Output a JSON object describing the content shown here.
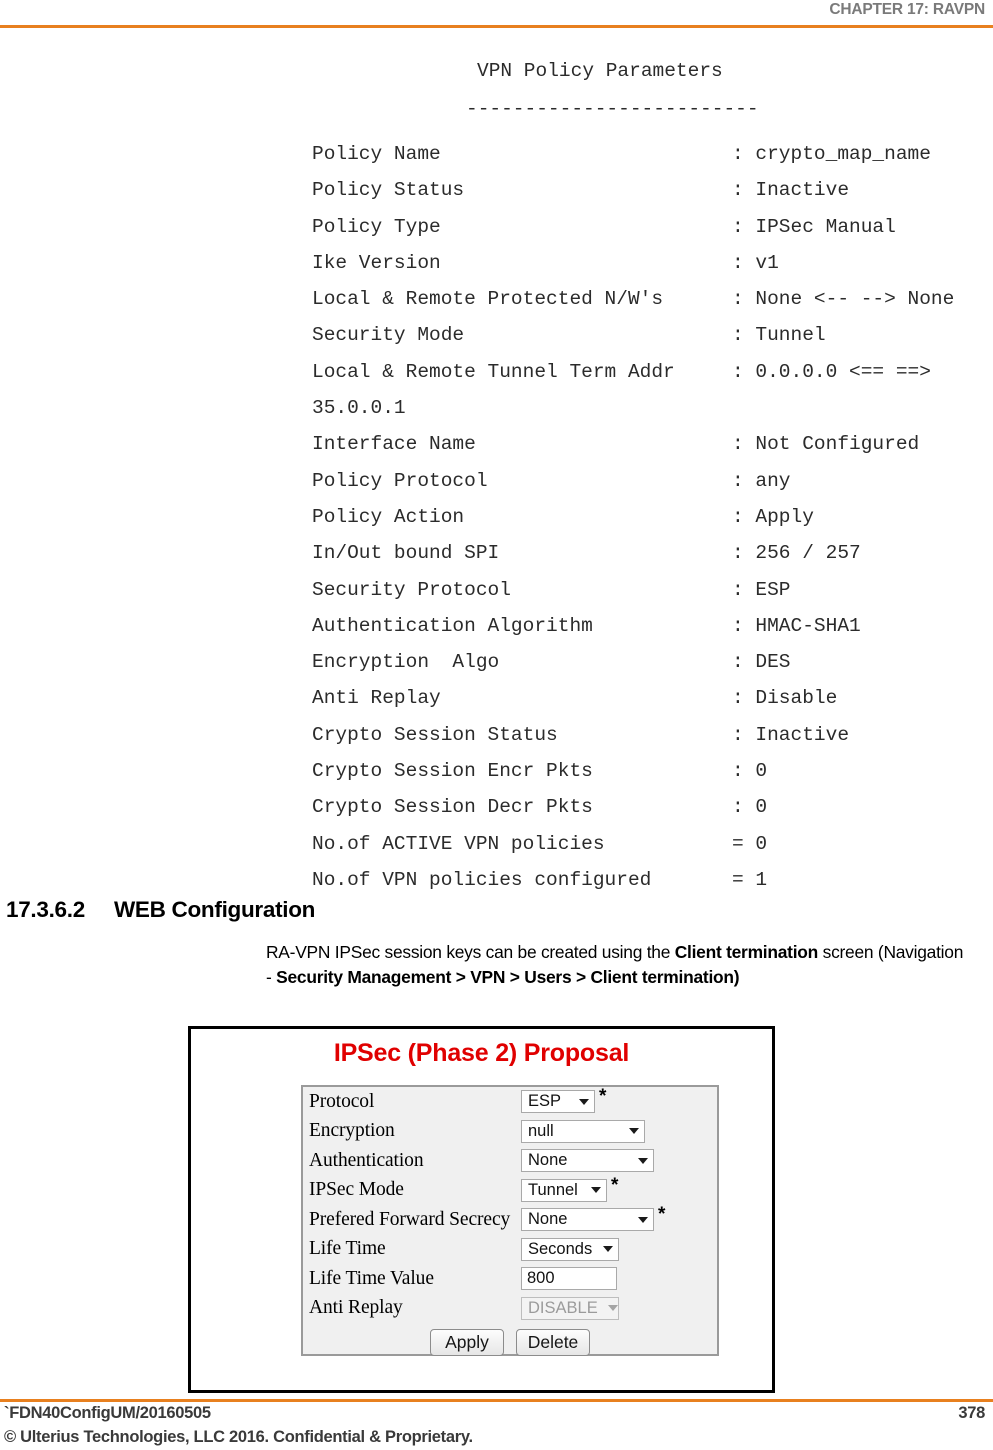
{
  "header": {
    "chapter": "CHAPTER 17: RAVPN"
  },
  "cli": {
    "title": "VPN Policy Parameters",
    "divider": "-------------------------",
    "rows": [
      {
        "key": "Policy Name",
        "value": ": crypto_map_name"
      },
      {
        "key": "Policy Status",
        "value": ": Inactive"
      },
      {
        "key": "Policy Type",
        "value": ": IPSec Manual"
      },
      {
        "key": "Ike Version",
        "value": ": v1"
      },
      {
        "key": "Local & Remote Protected N/W's",
        "value": ": None <-- --> None"
      },
      {
        "key": "Security Mode",
        "value": ": Tunnel"
      },
      {
        "key": "Local & Remote Tunnel Term Addr",
        "value": ": 0.0.0.0 <== ==> 35.0.0.1"
      },
      {
        "key": "Interface Name",
        "value": ": Not Configured"
      },
      {
        "key": "Policy Protocol",
        "value": ": any"
      },
      {
        "key": "Policy Action",
        "value": ": Apply"
      },
      {
        "key": "In/Out bound SPI",
        "value": ": 256 / 257"
      },
      {
        "key": "Security Protocol",
        "value": ": ESP"
      },
      {
        "key": "Authentication Algorithm",
        "value": ": HMAC-SHA1"
      },
      {
        "key": "Encryption  Algo",
        "value": ": DES"
      },
      {
        "key": "Anti Replay",
        "value": ": Disable"
      },
      {
        "key": "Crypto Session Status",
        "value": ": Inactive"
      },
      {
        "key": "Crypto Session Encr Pkts",
        "value": ": 0"
      },
      {
        "key": "Crypto Session Decr Pkts",
        "value": ": 0"
      },
      {
        "key": "No.of ACTIVE VPN policies",
        "value": "= 0"
      },
      {
        "key": "No.of VPN policies configured",
        "value": "= 1"
      }
    ]
  },
  "section": {
    "number": "17.3.6.2",
    "title": "WEB Configuration",
    "paragraph": {
      "part1": "RA-VPN IPSec session keys can be created using the ",
      "bold1": "Client termination",
      "part2": " screen (Navigation - ",
      "bold2": "Security Management > VPN > Users > Client termination)"
    }
  },
  "screenshot": {
    "title": "IPSec (Phase 2) Proposal",
    "title_color": "#e00000",
    "rows": [
      {
        "label": "Protocol",
        "control": "dropdown",
        "value": "ESP",
        "width": "w-short",
        "required": "*",
        "disabled": false
      },
      {
        "label": "Encryption",
        "control": "dropdown",
        "value": "null",
        "width": "w-med",
        "required": "",
        "disabled": false
      },
      {
        "label": "Authentication",
        "control": "dropdown",
        "value": "None",
        "width": "w-wide",
        "required": "",
        "disabled": false
      },
      {
        "label": "IPSec Mode",
        "control": "dropdown",
        "value": "Tunnel",
        "width": "w-tunnel",
        "required": "*",
        "disabled": false
      },
      {
        "label": "Prefered Forward Secrecy",
        "control": "dropdown",
        "value": "None",
        "width": "w-wide",
        "required": "*",
        "disabled": false
      },
      {
        "label": "Life Time",
        "control": "dropdown",
        "value": "Seconds",
        "width": "w-sec",
        "required": "",
        "disabled": false
      },
      {
        "label": "Life Time Value",
        "control": "input",
        "value": "800",
        "width": "",
        "required": "",
        "disabled": false
      },
      {
        "label": "Anti Replay",
        "control": "dropdown",
        "value": "DISABLE",
        "width": "w-dis",
        "required": "",
        "disabled": true
      }
    ],
    "buttons": [
      {
        "label": "Apply"
      },
      {
        "label": "Delete"
      }
    ]
  },
  "footer": {
    "doc": "`FDN40ConfigUM/20160505",
    "page": "378",
    "copyright": "© Ulterius Technologies, LLC 2016. Confidential & Proprietary.",
    "rule_color": "#e8801f"
  }
}
